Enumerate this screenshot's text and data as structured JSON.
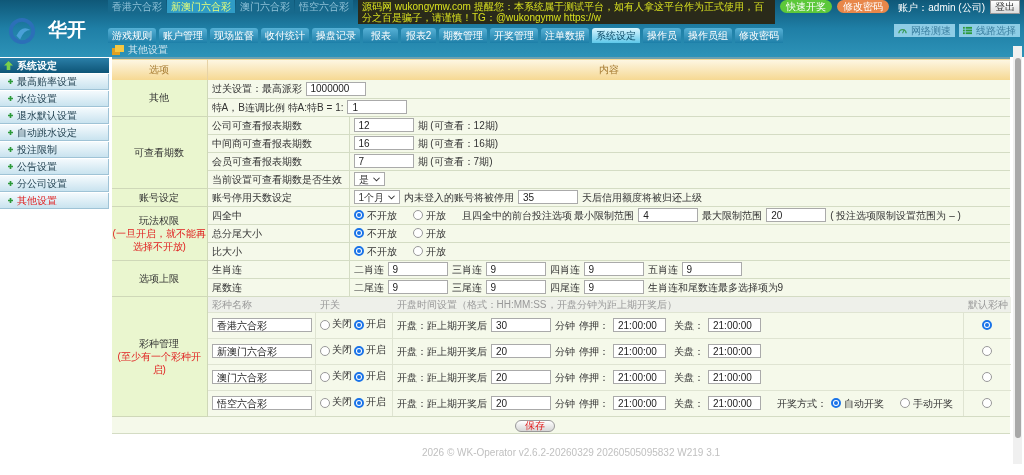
{
  "logo": {
    "text": "华开"
  },
  "lottery_tabs": [
    {
      "label": "香港六合彩",
      "selected": false
    },
    {
      "label": "新澳门六合彩",
      "selected": true
    },
    {
      "label": "澳门六合彩",
      "selected": false
    },
    {
      "label": "悟空六合彩",
      "selected": false
    }
  ],
  "notice": "源码网 wukongymw.com 提醒您：本系统属于测试平台，如有人拿这平台作为正式使用，百分之百是骗子，请谨慎！TG：@wukongymw https://w",
  "header_buttons": [
    {
      "label": "快速开奖",
      "color": "#5cc83a"
    },
    {
      "label": "修改密码",
      "color": "#e8874a"
    }
  ],
  "account": "账户：admin (公司)",
  "logout": "登出",
  "tools": [
    {
      "kind": "speed",
      "label": "网络测速"
    },
    {
      "kind": "lines",
      "label": "线路选择"
    }
  ],
  "nav_tabs": [
    {
      "label": "游戏规则",
      "selected": false
    },
    {
      "label": "账户管理",
      "selected": false
    },
    {
      "label": "现场监督",
      "selected": false
    },
    {
      "label": "收付统计",
      "selected": false
    },
    {
      "label": "操盘记录",
      "selected": false
    },
    {
      "label": "报表",
      "selected": false
    },
    {
      "label": "报表2",
      "selected": false
    },
    {
      "label": "期数管理",
      "selected": false
    },
    {
      "label": "开奖管理",
      "selected": false
    },
    {
      "label": "注单数据",
      "selected": false
    },
    {
      "label": "系统设定",
      "selected": true
    },
    {
      "label": "操作员",
      "selected": false
    },
    {
      "label": "操作员组",
      "selected": false
    },
    {
      "label": "修改密码",
      "selected": false
    }
  ],
  "breadcrumb": "其他设置",
  "sidebar": {
    "title": "系统设定",
    "items": [
      {
        "label": "最高赔率设置",
        "selected": false
      },
      {
        "label": "水位设置",
        "selected": false
      },
      {
        "label": "退水默认设置",
        "selected": false
      },
      {
        "label": "自动跳水设定",
        "selected": false
      },
      {
        "label": "投注限制",
        "selected": false
      },
      {
        "label": "公告设置",
        "selected": false
      },
      {
        "label": "分公司设置",
        "selected": false
      },
      {
        "label": "其他设置",
        "selected": true
      }
    ]
  },
  "table": {
    "columns": [
      "选项",
      "内容"
    ],
    "sections": [
      {
        "kind": "form",
        "label": "其他",
        "rows": [
          {
            "parts": [
              {
                "kind": "text",
                "text": "过关设置：最高派彩"
              },
              {
                "kind": "input",
                "value": "1000000"
              }
            ]
          },
          {
            "parts": [
              {
                "kind": "text",
                "text": "特A，B连调比例 特A:特B = 1:"
              },
              {
                "kind": "input",
                "value": "1"
              }
            ]
          }
        ]
      },
      {
        "kind": "form",
        "label": "可查看期数",
        "rows": [
          {
            "label": "公司可查看报表期数",
            "parts": [
              {
                "kind": "input",
                "value": "12"
              },
              {
                "kind": "text",
                "text": "期 (可查看：12期)"
              }
            ]
          },
          {
            "label": "中间商可查看报表期数",
            "parts": [
              {
                "kind": "input",
                "value": "16"
              },
              {
                "kind": "text",
                "text": "期 (可查看：16期)"
              }
            ]
          },
          {
            "label": "会员可查看报表期数",
            "parts": [
              {
                "kind": "input",
                "value": "7"
              },
              {
                "kind": "text",
                "text": "期 (可查看：7期)"
              }
            ]
          },
          {
            "label": "当前设置可查看期数是否生效",
            "parts": [
              {
                "kind": "select",
                "value": "是"
              }
            ]
          }
        ]
      },
      {
        "kind": "form",
        "label": "账号设定",
        "rows": [
          {
            "label": "账号停用天数设定",
            "parts": [
              {
                "kind": "select",
                "value": "1个月"
              },
              {
                "kind": "text",
                "text": "内未登入的账号将被停用"
              },
              {
                "kind": "input",
                "value": "35"
              },
              {
                "kind": "text",
                "text": "天后信用额度将被归还上级"
              }
            ]
          }
        ]
      },
      {
        "kind": "form",
        "label": "玩法权限",
        "note": "(一旦开启，就不能再选择不开放)",
        "rows": [
          {
            "label": "四全中",
            "parts": [
              {
                "kind": "radio",
                "label": "不开放",
                "selected": true
              },
              {
                "kind": "radio",
                "label": "开放",
                "selected": false
              },
              {
                "kind": "text",
                "text": "且四全中的前台投注选项 最小限制范围"
              },
              {
                "kind": "input",
                "value": "4"
              },
              {
                "kind": "text",
                "text": "最大限制范围"
              },
              {
                "kind": "input",
                "value": "20"
              },
              {
                "kind": "text",
                "text": "( 投注选项限制设置范围为 – )"
              }
            ]
          },
          {
            "label": "总分尾大小",
            "parts": [
              {
                "kind": "radio",
                "label": "不开放",
                "selected": true
              },
              {
                "kind": "radio",
                "label": "开放",
                "selected": false
              }
            ]
          },
          {
            "label": "比大小",
            "parts": [
              {
                "kind": "radio",
                "label": "不开放",
                "selected": true
              },
              {
                "kind": "radio",
                "label": "开放",
                "selected": false
              }
            ]
          }
        ]
      },
      {
        "kind": "form",
        "label": "选项上限",
        "rows": [
          {
            "label": "生肖连",
            "parts": [
              {
                "kind": "text",
                "text": "二肖连"
              },
              {
                "kind": "input",
                "value": "9"
              },
              {
                "kind": "text",
                "text": "三肖连"
              },
              {
                "kind": "input",
                "value": "9"
              },
              {
                "kind": "text",
                "text": "四肖连"
              },
              {
                "kind": "input",
                "value": "9"
              },
              {
                "kind": "text",
                "text": "五肖连"
              },
              {
                "kind": "input",
                "value": "9"
              }
            ]
          },
          {
            "label": "尾数连",
            "parts": [
              {
                "kind": "text",
                "text": "二尾连"
              },
              {
                "kind": "input",
                "value": "9"
              },
              {
                "kind": "text",
                "text": "三尾连"
              },
              {
                "kind": "input",
                "value": "9"
              },
              {
                "kind": "text",
                "text": "四尾连"
              },
              {
                "kind": "input",
                "value": "9"
              },
              {
                "kind": "text",
                "text": "生肖连和尾数连最多选择项为9"
              }
            ]
          }
        ]
      },
      {
        "kind": "lottery",
        "label": "彩种管理",
        "note": "(至少有一个彩种开启)",
        "columns": [
          "彩种名称",
          "开关",
          "开盘时间设置（格式：HH:MM:SS，开盘分钟为距上期开奖后）",
          "默认彩种"
        ],
        "rows": [
          {
            "name": "香港六合彩",
            "switch": [
              {
                "label": "关闭",
                "selected": false
              },
              {
                "label": "开启",
                "selected": true
              }
            ],
            "open_label": "开盘：距上期开奖后",
            "open_minutes": "30",
            "unit": "分钟",
            "stop_label": "停押：",
            "stop_time": "21:00:00",
            "close_label": "关盘：",
            "close_time": "21:00:00",
            "default": true
          },
          {
            "name": "新澳门六合彩",
            "switch": [
              {
                "label": "关闭",
                "selected": false
              },
              {
                "label": "开启",
                "selected": true
              }
            ],
            "open_label": "开盘：距上期开奖后",
            "open_minutes": "20",
            "unit": "分钟",
            "stop_label": "停押：",
            "stop_time": "21:00:00",
            "close_label": "关盘：",
            "close_time": "21:00:00",
            "default": false
          },
          {
            "name": "澳门六合彩",
            "switch": [
              {
                "label": "关闭",
                "selected": false
              },
              {
                "label": "开启",
                "selected": true
              }
            ],
            "open_label": "开盘：距上期开奖后",
            "open_minutes": "20",
            "unit": "分钟",
            "stop_label": "停押：",
            "stop_time": "21:00:00",
            "close_label": "关盘：",
            "close_time": "21:00:00",
            "default": false
          },
          {
            "name": "悟空六合彩",
            "switch": [
              {
                "label": "关闭",
                "selected": false
              },
              {
                "label": "开启",
                "selected": true
              }
            ],
            "open_label": "开盘：距上期开奖后",
            "open_minutes": "20",
            "unit": "分钟",
            "stop_label": "停押：",
            "stop_time": "21:00:00",
            "close_label": "关盘：",
            "close_time": "21:00:00",
            "draw_mode": {
              "label": "开奖方式：",
              "options": [
                {
                  "label": "自动开奖",
                  "selected": true
                },
                {
                  "label": "手动开奖",
                  "selected": false
                }
              ]
            },
            "default": false
          }
        ]
      }
    ]
  },
  "save_button": "保存",
  "footer": "2026 © WK-Operator v2.6.2-20260329 20260505095832 W219 3.1"
}
